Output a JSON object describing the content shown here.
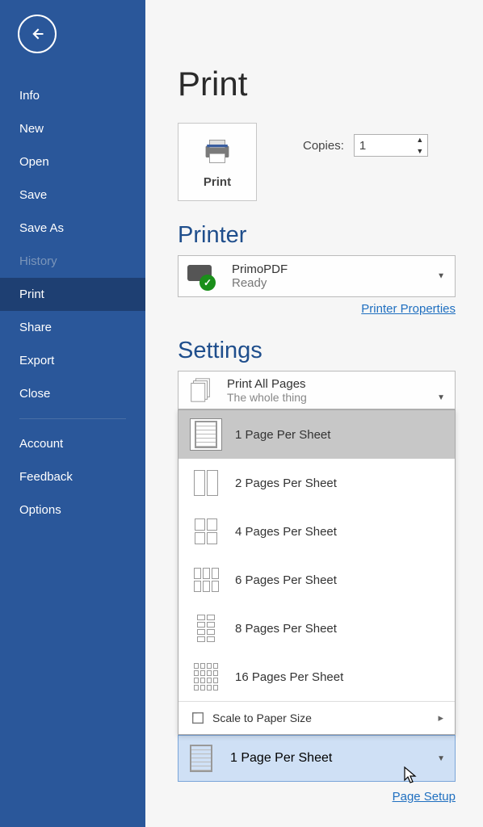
{
  "sidebar": {
    "items": [
      {
        "label": "Info"
      },
      {
        "label": "New"
      },
      {
        "label": "Open"
      },
      {
        "label": "Save"
      },
      {
        "label": "Save As"
      },
      {
        "label": "History"
      },
      {
        "label": "Print"
      },
      {
        "label": "Share"
      },
      {
        "label": "Export"
      },
      {
        "label": "Close"
      },
      {
        "label": "Account"
      },
      {
        "label": "Feedback"
      },
      {
        "label": "Options"
      }
    ]
  },
  "page": {
    "title": "Print"
  },
  "print_button": {
    "label": "Print"
  },
  "copies": {
    "label": "Copies:",
    "value": "1"
  },
  "printer_section": {
    "title": "Printer"
  },
  "printer": {
    "name": "PrimoPDF",
    "status": "Ready",
    "properties_link": "Printer Properties"
  },
  "settings_section": {
    "title": "Settings"
  },
  "print_pages": {
    "title": "Print All Pages",
    "subtitle": "The whole thing"
  },
  "pages_per_sheet": {
    "options": [
      {
        "label": "1 Page Per Sheet"
      },
      {
        "label": "2 Pages Per Sheet"
      },
      {
        "label": "4 Pages Per Sheet"
      },
      {
        "label": "6 Pages Per Sheet"
      },
      {
        "label": "8 Pages Per Sheet"
      },
      {
        "label": "16 Pages Per Sheet"
      }
    ],
    "scale_label": "Scale to Paper Size",
    "current": "1 Page Per Sheet"
  },
  "page_setup_link": "Page Setup"
}
